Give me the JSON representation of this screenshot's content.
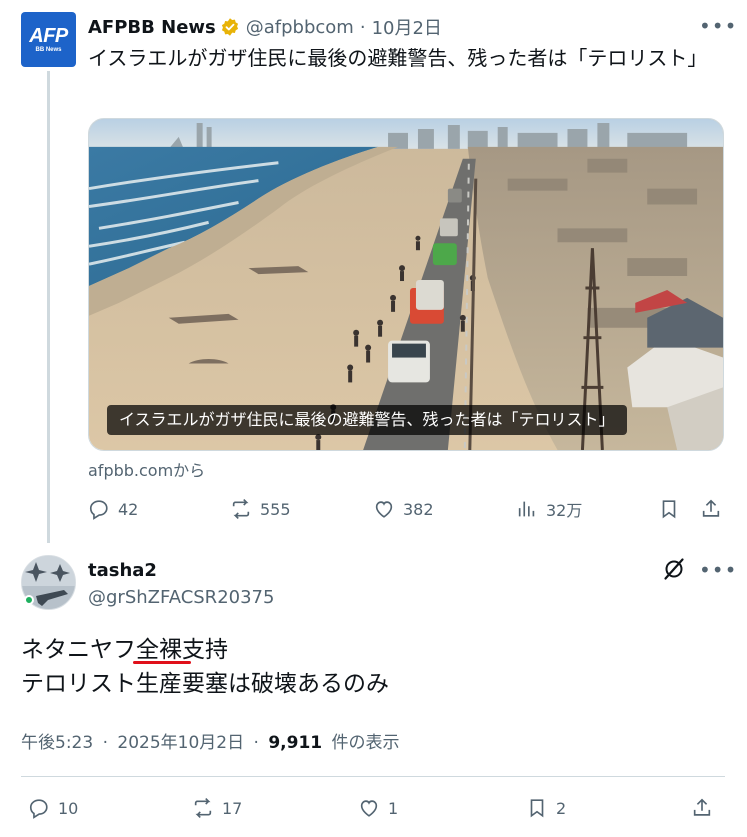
{
  "parent_tweet": {
    "avatar_logo": "AFP",
    "avatar_logo_sub": "BB News",
    "display_name": "AFPBB News",
    "handle": "@afpbbcom",
    "separator": "·",
    "date": "10月2日",
    "text": "イスラエルがガザ住民に最後の避難警告、残った者は「テロリスト」",
    "media_caption": "イスラエルがガザ住民に最後の避難警告、残った者は「テロリスト」",
    "source": "afpbb.comから",
    "stats": {
      "replies": "42",
      "reposts": "555",
      "likes": "382",
      "views": "32万"
    },
    "icons": [
      "verified-badge-icon",
      "more-icon",
      "reply-icon",
      "repost-icon",
      "like-icon",
      "views-icon",
      "bookmark-icon",
      "share-icon"
    ]
  },
  "reply_tweet": {
    "display_name": "tasha2",
    "handle": "@grShZFACSR20375",
    "body_line1": "ネタニヤフ全裸支持",
    "body_line2": "テロリスト生産要塞は破壊あるのみ",
    "time": "午後5:23",
    "dot": "·",
    "date": "2025年10月2日",
    "view_count": "9,911",
    "view_label": "件の表示",
    "stats": {
      "replies": "10",
      "reposts": "17",
      "likes": "1",
      "bookmarks": "2"
    },
    "icons": [
      "grok-icon",
      "more-icon",
      "reply-icon",
      "repost-icon",
      "like-icon",
      "bookmark-icon",
      "share-icon"
    ]
  },
  "colors": {
    "text": "#0f1419",
    "muted": "#536471",
    "afp_blue": "#1d63c9",
    "verified_gold": "#e8b308",
    "annotation_red": "#e0101a",
    "border": "#cfd9de"
  }
}
